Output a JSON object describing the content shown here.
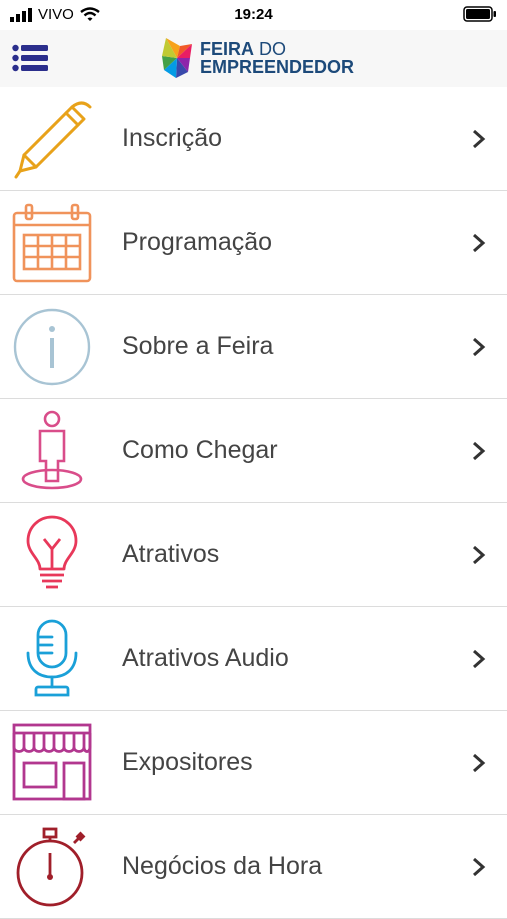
{
  "status_bar": {
    "carrier": "VIVO",
    "time": "19:24"
  },
  "header": {
    "logo_line1_bold": "FEIRA",
    "logo_line1_thin": " DO",
    "logo_line2": "EMPREENDEDOR"
  },
  "menu": {
    "items": [
      {
        "label": "Inscrição",
        "icon": "pen-icon",
        "color": "#e8a21a"
      },
      {
        "label": "Programação",
        "icon": "calendar-icon",
        "color": "#f0935b"
      },
      {
        "label": "Sobre a Feira",
        "icon": "info-icon",
        "color": "#a8c4d4"
      },
      {
        "label": "Como Chegar",
        "icon": "person-location-icon",
        "color": "#d94d8a"
      },
      {
        "label": "Atrativos",
        "icon": "lightbulb-icon",
        "color": "#e8385a"
      },
      {
        "label": "Atrativos Audio",
        "icon": "microphone-icon",
        "color": "#1aa0d8"
      },
      {
        "label": "Expositores",
        "icon": "storefront-icon",
        "color": "#b2378f"
      },
      {
        "label": "Negócios da Hora",
        "icon": "stopwatch-icon",
        "color": "#a01f2a"
      }
    ]
  }
}
